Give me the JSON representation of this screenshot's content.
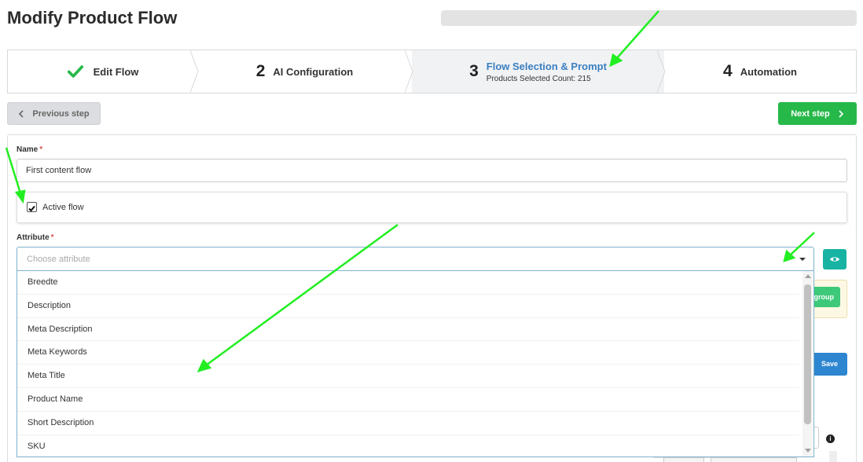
{
  "page": {
    "title": "Modify Product Flow"
  },
  "steps": [
    {
      "label": "Edit Flow",
      "icon": "check-icon",
      "state": "done"
    },
    {
      "number": "2",
      "label": "AI Configuration"
    },
    {
      "number": "3",
      "label": "Flow Selection & Prompt",
      "subtitle": "Products Selected Count: 215",
      "state": "active"
    },
    {
      "number": "4",
      "label": "Automation"
    }
  ],
  "nav": {
    "previous": "Previous step",
    "next": "Next step"
  },
  "form": {
    "name_label": "Name",
    "required_mark": "*",
    "name_value": "First content flow",
    "active_label": "Active flow",
    "active_checked": true,
    "attribute_label": "Attribute",
    "attribute_placeholder": "Choose attribute",
    "attribute_options": [
      "Breedte",
      "Description",
      "Meta Description",
      "Meta Keywords",
      "Meta Title",
      "Product Name",
      "Short Description",
      "SKU"
    ]
  },
  "side": {
    "group_button": "group",
    "save_button": "Save",
    "info_glyph": "i"
  },
  "colors": {
    "next_button": "#27b84a",
    "active_step_text": "#3a7fc1",
    "eye_button": "#17b3a3",
    "save_button": "#2e86d0",
    "annotation_arrow": "#22ee22"
  }
}
